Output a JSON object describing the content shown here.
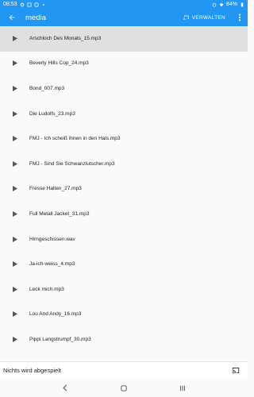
{
  "status_bar": {
    "time": "08:53",
    "battery": "84%"
  },
  "app_bar": {
    "title": "media",
    "manage_label": "VERWALTEN"
  },
  "files": [
    "Arschloch Des Monats_15.mp3",
    "Beverly Hills Cop_24.mp3",
    "Bond_007.mp3",
    "Die Ludolfs_23.mp3",
    "FMJ - Ich scheiß ihnen in den Hals.mp3",
    "FMJ - Sind Sie Schwanzlutscher.mp3",
    "Fresse Halten_27.mp3",
    "Full Metall Jacket_31.mp3",
    "Hirngeschissen.wav",
    "Ja-ich-weiss_4.mp3",
    "Leck mich.mp3",
    "Lou And Andy_16.mp3",
    "Pippi Langstrumpf_30.mp3"
  ],
  "now_playing": {
    "text": "Nichts wird abgespielt"
  },
  "colors": {
    "accent": "#2196f3",
    "selected_row": "#e0e0e0"
  },
  "icons": {
    "back": "arrow-back-icon",
    "manage": "cast-manage-icon",
    "more": "more-vert-icon",
    "play": "play-arrow-icon",
    "cast": "cast-icon"
  }
}
